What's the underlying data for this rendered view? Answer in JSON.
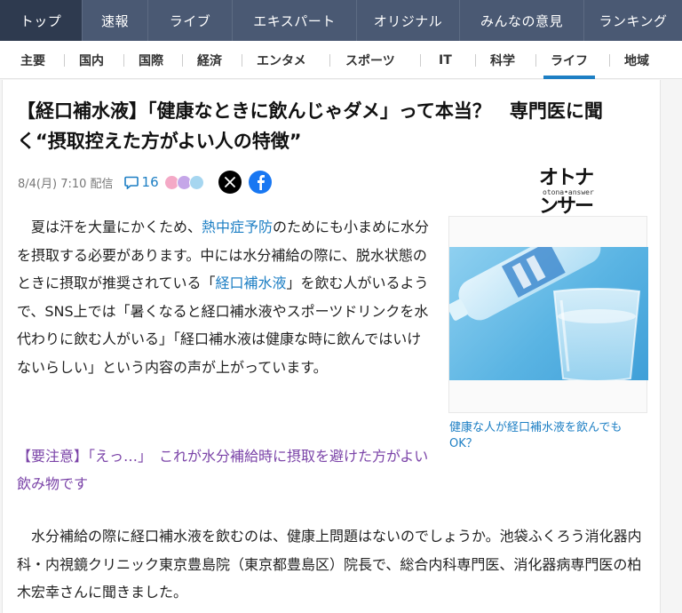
{
  "topnav": {
    "tabs": [
      {
        "label": "トップ",
        "active": true
      },
      {
        "label": "速報"
      },
      {
        "label": "ライブ"
      },
      {
        "label": "エキスパート"
      },
      {
        "label": "オリジナル"
      },
      {
        "label": "みんなの意見"
      },
      {
        "label": "ランキング"
      }
    ]
  },
  "subnav": {
    "items": [
      {
        "label": "主要"
      },
      {
        "label": "国内"
      },
      {
        "label": "国際"
      },
      {
        "label": "経済"
      },
      {
        "label": "エンタメ"
      },
      {
        "label": "スポーツ"
      },
      {
        "label": "IT"
      },
      {
        "label": "科学"
      },
      {
        "label": "ライフ",
        "active": true
      },
      {
        "label": "地域"
      }
    ]
  },
  "article": {
    "title": "【経口補水液】「健康なときに飲んじゃダメ」って本当？　専門医に聞く“摂取控えた方がよい人の特徴”",
    "date": "8/4(月) 7:10 配信",
    "comment_count": "16",
    "publisher_logo_text": "オトナンサー",
    "publisher_logo_sub": "otona•answer",
    "body1_a": "夏は汗を大量にかくため、",
    "body1_link1": "熱中症予防",
    "body1_b": "のためにも小まめに水分を摂取する必要があります。中には水分補給の際に、脱水状態のときに摂取が推奨されている「",
    "body1_link2": "経口補水液",
    "body1_c": "」を飲む人がいるようで、SNS上では「暑くなると経口補水液やスポーツドリンクを水代わりに飲む人がいる」「経口補水液は健康な時に飲んではいけないらしい」という内容の声が上がっています。",
    "related_link": "【要注意】「えっ…」　これが水分補給時に摂取を避けた方がよい飲み物です",
    "image_caption": "健康な人が経口補水液を飲んでもOK？",
    "body2": "水分補給の際に経口補水液を飲むのは、健康上問題はないのでしょうか。池袋ふくろう消化器内科・内視鏡クリニック東京豊島院（東京都豊島区）院長で、総合内科専門医、消化器病専門医の柏木宏幸さんに聞きました。"
  },
  "icons": {
    "comment": "speech-bubble-icon",
    "x": "x-logo-icon",
    "facebook": "facebook-logo-icon"
  },
  "colors": {
    "topnav_bg": "#4a5973",
    "accent_blue": "#1d7fc4",
    "related_purple": "#7b44a8"
  }
}
